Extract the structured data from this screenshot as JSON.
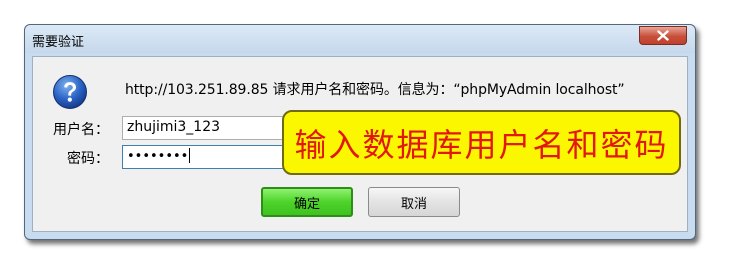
{
  "dialog": {
    "title": "需要验证",
    "message": "http://103.251.89.85 请求用户名和密码。信息为：“phpMyAdmin localhost”",
    "username_label": "用户名：",
    "username_value": "zhujimi3_123",
    "password_label": "密码：",
    "password_masked": "••••••••",
    "ok_label": "确定",
    "cancel_label": "取消",
    "close_icon": "close-icon",
    "info_icon": "question-icon"
  },
  "annotation": {
    "text": "输入数据库用户名和密码",
    "background_color": "#fbf701",
    "text_color": "#e2170e"
  }
}
